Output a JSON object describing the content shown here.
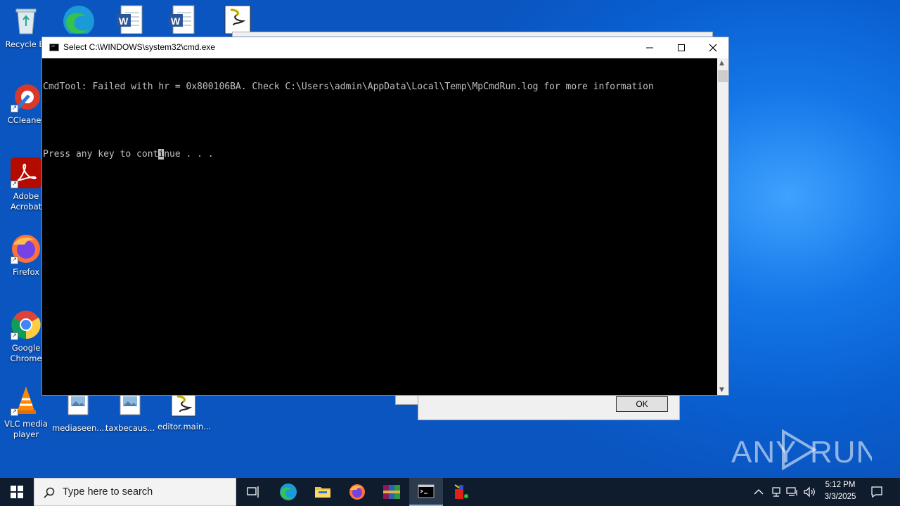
{
  "desktop": {
    "icons": [
      {
        "label": "Recycle Bin",
        "display": "Recycle Bi"
      },
      {
        "label": "CCleaner"
      },
      {
        "label": "Adobe Acrobat",
        "display": "Adobe\nAcrobat"
      },
      {
        "label": "Firefox"
      },
      {
        "label": "Google Chrome",
        "display": "Google\nChrome"
      },
      {
        "label": "VLC media player",
        "display": "VLC media\nplayer"
      },
      {
        "label": "mediaseen...."
      },
      {
        "label": "taxbecaus..."
      },
      {
        "label": "editor.main..."
      }
    ]
  },
  "dialog": {
    "ok_label": "OK"
  },
  "cmd_window": {
    "title": "Select C:\\WINDOWS\\system32\\cmd.exe",
    "lines": [
      "CmdTool: Failed with hr = 0x800106BA. Check C:\\Users\\admin\\AppData\\Local\\Temp\\MpCmdRun.log for more information",
      "",
      "Press any key to continue . . ."
    ],
    "cursor_before": "Press any key to cont",
    "cursor_char": "i",
    "cursor_after": "nue . . ."
  },
  "taskbar": {
    "search_placeholder": "Type here to search",
    "time": "5:12 PM",
    "date": "3/3/2025",
    "apps": [
      "task-view",
      "edge",
      "file-explorer",
      "firefox",
      "winrar",
      "cmd",
      "app"
    ]
  },
  "watermark": "ANY RUN"
}
